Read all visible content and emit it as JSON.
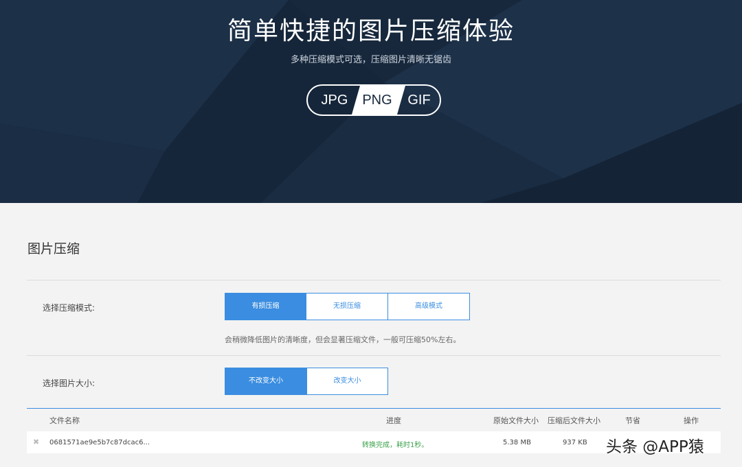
{
  "hero": {
    "title": "简单快捷的图片压缩体验",
    "subtitle": "多种压缩模式可选，压缩图片清晰无锯齿",
    "formats": [
      "JPG",
      "PNG",
      "GIF"
    ]
  },
  "main": {
    "section_title": "图片压缩",
    "mode": {
      "label": "选择压缩模式:",
      "options": [
        "有损压缩",
        "无损压缩",
        "高级模式"
      ],
      "selected": "有损压缩",
      "hint": "会稍微降低图片的清晰度，但会显著压缩文件，一般可压缩50%左右。"
    },
    "size": {
      "label": "选择图片大小:",
      "options": [
        "不改变大小",
        "改变大小"
      ],
      "selected": "不改变大小"
    }
  },
  "table": {
    "headers": [
      "文件名称",
      "进度",
      "原始文件大小",
      "压缩后文件大小",
      "节省",
      "操作"
    ],
    "rows": [
      {
        "name": "0681571ae9e5b7c87dcac6...",
        "progress": "转换完成，耗时1秒。",
        "original": "5.38 MB",
        "compressed": "937 KB"
      }
    ]
  },
  "watermark": "头条 @APP猿",
  "colors": {
    "hero_bg": "#17283c",
    "accent": "#3a8de0",
    "success": "#3aa24a",
    "page_bg": "#f3f3f3"
  }
}
